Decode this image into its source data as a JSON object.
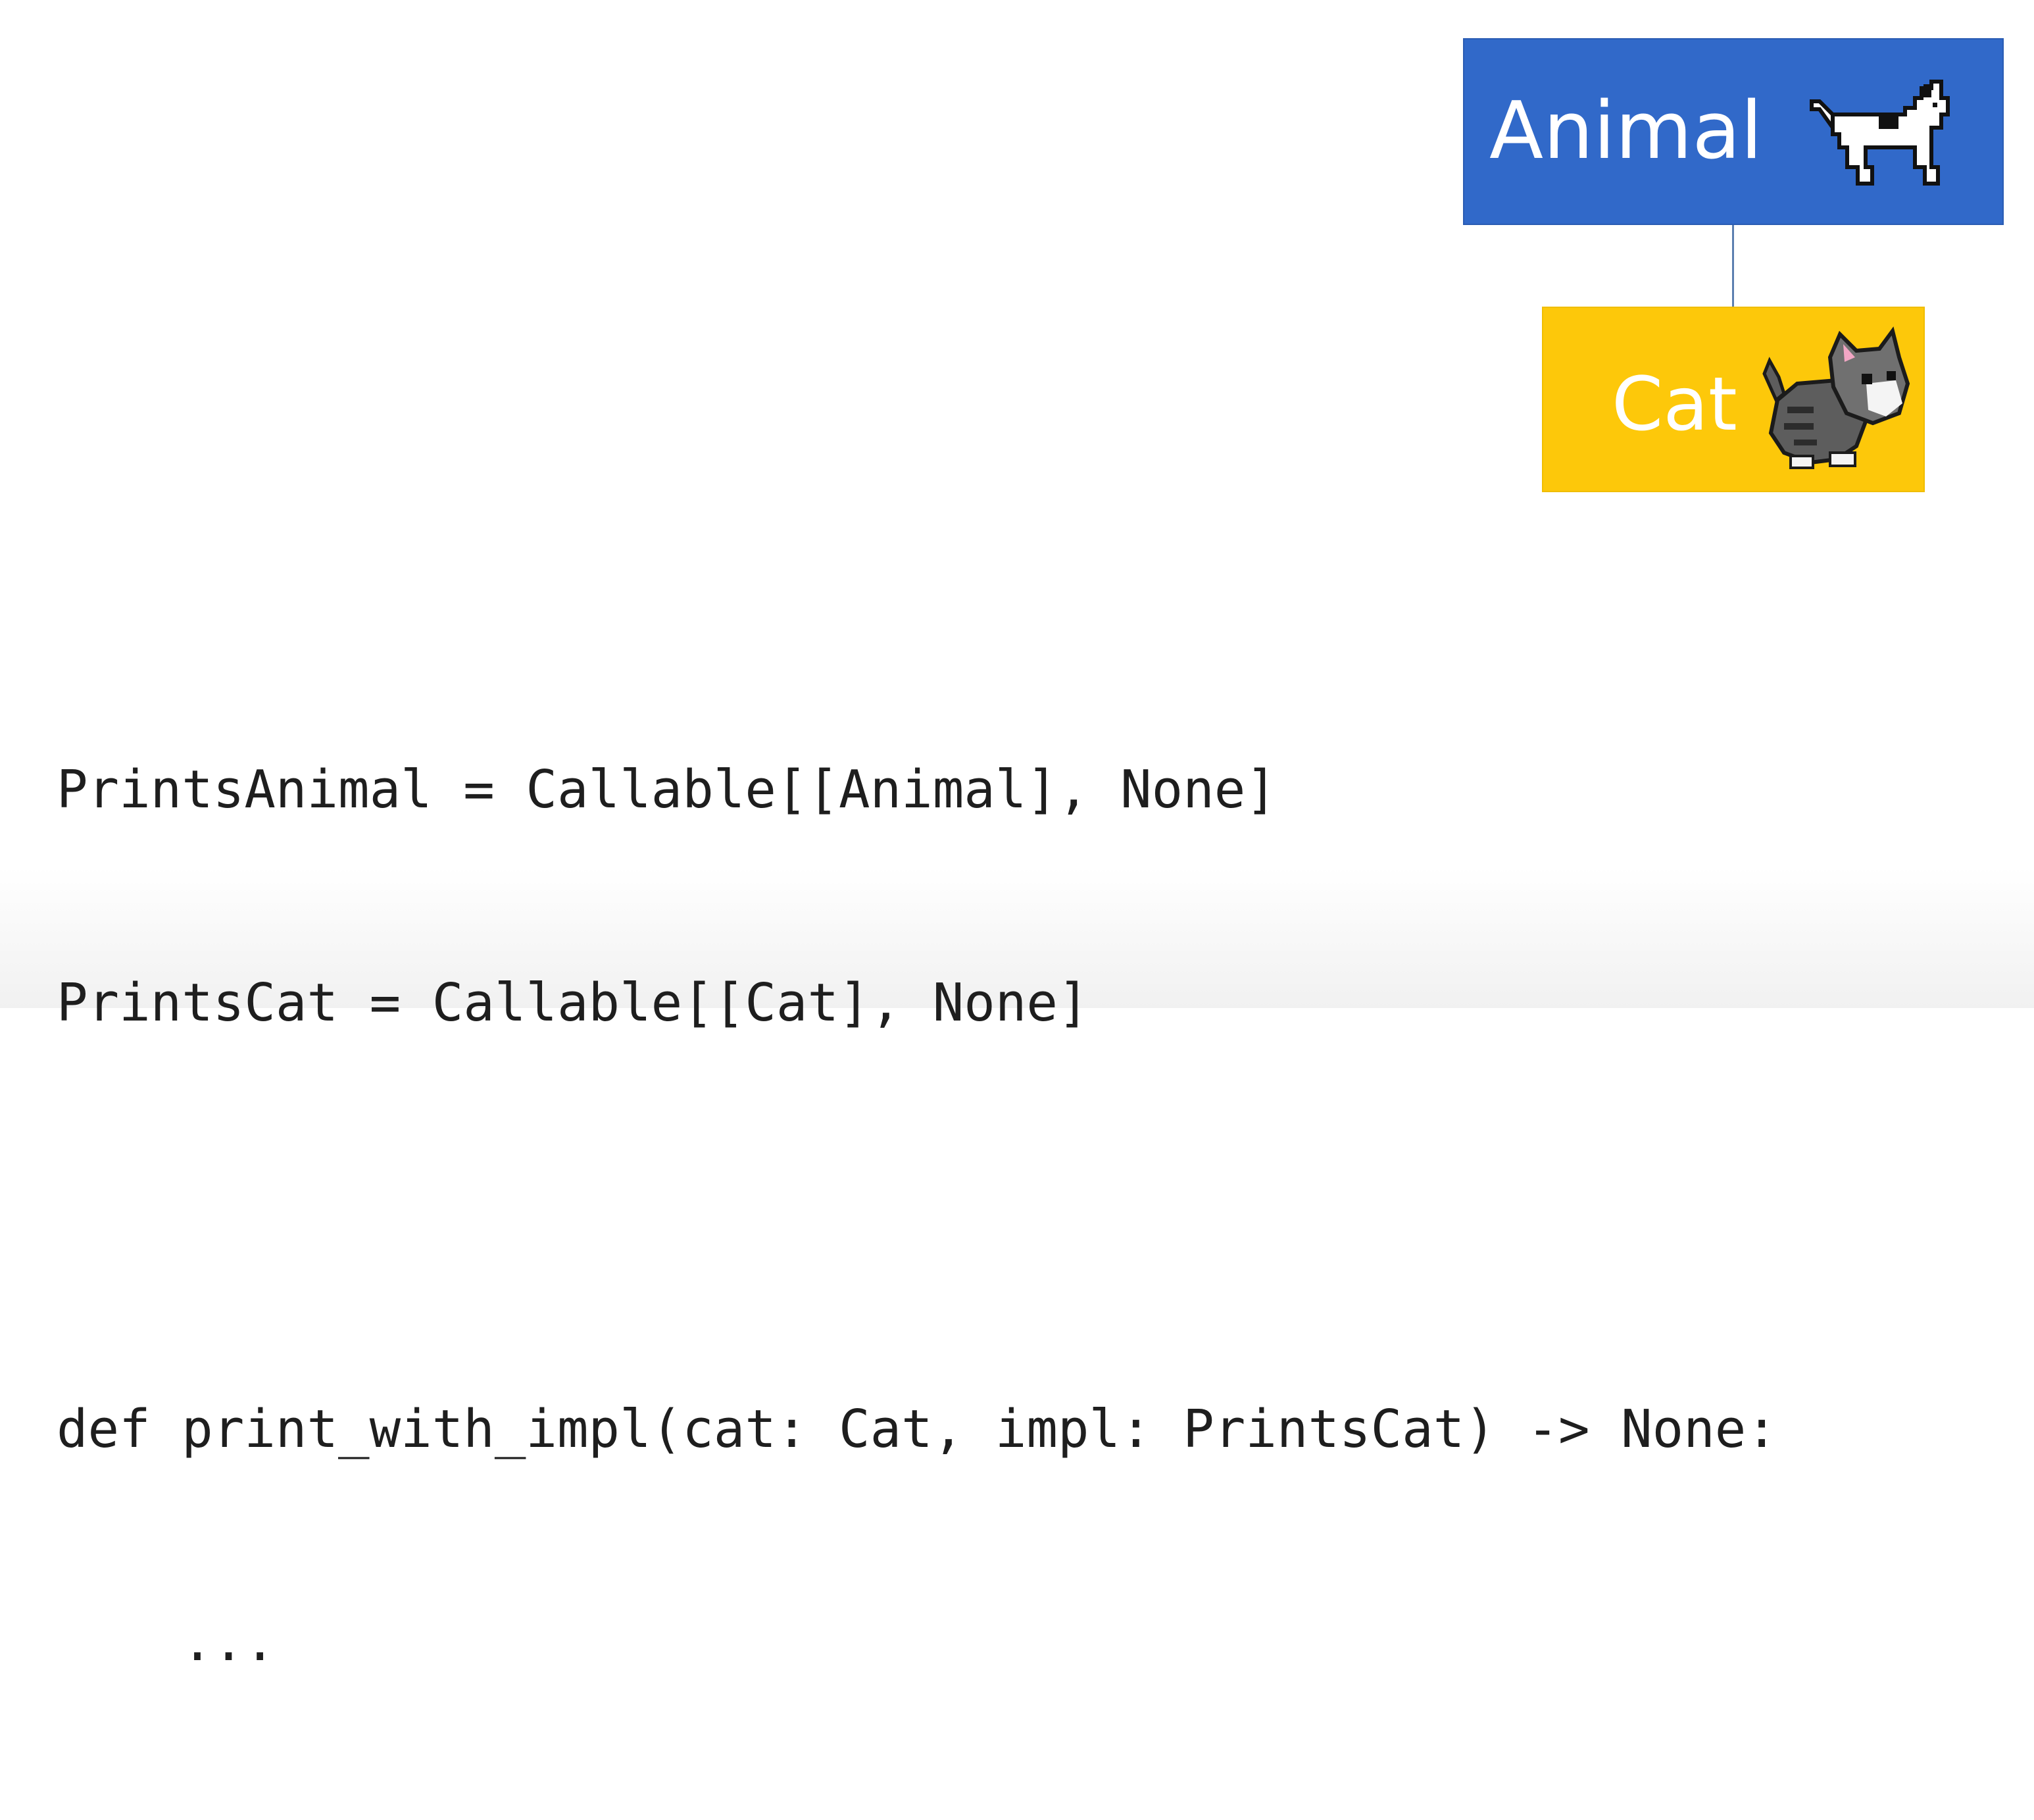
{
  "diagram": {
    "parent_class": {
      "label": "Animal",
      "color": "#3169c9",
      "icon": "dog-icon"
    },
    "child_class": {
      "label": "Cat",
      "color": "#fdc80a",
      "icon": "cat-icon"
    }
  },
  "code": {
    "lines": [
      "PrintsAnimal = Callable[[Animal], None]",
      "PrintsCat = Callable[[Cat], None]",
      "",
      "def print_with_impl(cat: Cat, impl: PrintsCat) -> None:",
      "    ..."
    ]
  }
}
